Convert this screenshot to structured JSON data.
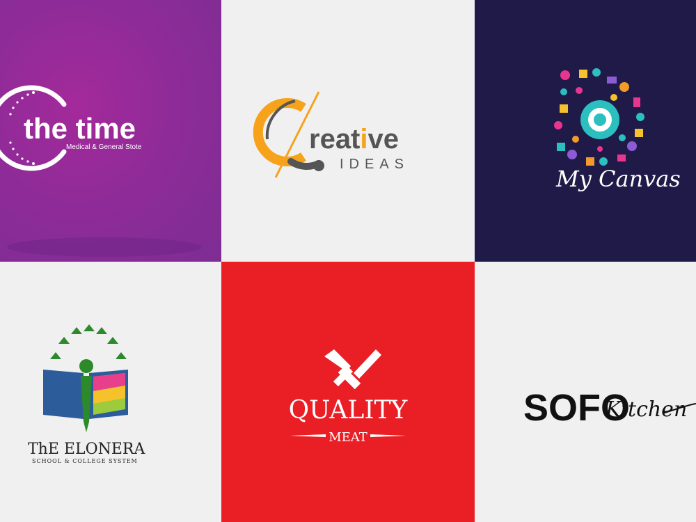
{
  "logos": [
    {
      "id": "the-time",
      "title": "the time",
      "subtitle": "Medical & General Stote",
      "bg": "#8f2b98"
    },
    {
      "id": "creative-ideas",
      "title_cap": "C",
      "title_rest": "reat",
      "title_i": "i",
      "title_end": "ve",
      "subtitle": "IDEAS",
      "bg": "#f0f0f0",
      "accent": "#f6a31b",
      "ink": "#555555"
    },
    {
      "id": "my-canvas",
      "title": "My Canvas",
      "bg": "#201a48"
    },
    {
      "id": "elonera",
      "title": "ThE ELONERA",
      "subtitle": "SCHOOL & COLLEGE SYSTEM",
      "bg": "#f0f0f0",
      "green": "#2c8a2b",
      "blue": "#2d5c9a"
    },
    {
      "id": "quality-meat",
      "title": "QUALITY",
      "subtitle": "MEAT",
      "bg": "#ea1f26"
    },
    {
      "id": "sofo-kitchen",
      "title": "SOFO",
      "script": "Kitchen",
      "bg": "#f0f0f0"
    }
  ]
}
